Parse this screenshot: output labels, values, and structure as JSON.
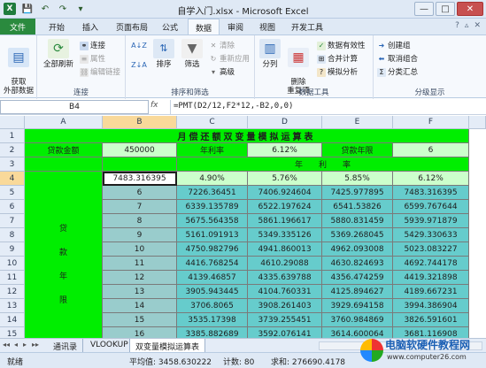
{
  "window": {
    "title": "自学入门.xlsx - Microsoft Excel",
    "minimize": "—",
    "restore": "□",
    "close": "✕"
  },
  "qat": {
    "logo": "X",
    "save": "💾",
    "undo": "↶",
    "redo": "↷",
    "more": "▾"
  },
  "tabs": [
    "文件",
    "开始",
    "插入",
    "页面布局",
    "公式",
    "数据",
    "审阅",
    "视图",
    "开发工具"
  ],
  "active_tab": "数据",
  "ribbon_right": {
    "help": "?",
    "min": "▵",
    "close": "✕"
  },
  "ribbon": {
    "groups": {
      "get_external": "获取\n外部数据",
      "connections": "连接",
      "sort_filter": "排序和筛选",
      "data_tools": "数据工具",
      "outline": "分级显示"
    },
    "buttons": {
      "get_data": "获取\n外部数据",
      "refresh_all": "全部刷新",
      "connections": "连接",
      "properties": "属性",
      "edit_links": "编辑链接",
      "sort_az": "A↓Z",
      "sort_za": "Z↓A",
      "sort": "排序",
      "filter": "筛选",
      "clear": "清除",
      "reapply": "重新应用",
      "advanced": "高级",
      "split": "分列",
      "remove_dup": "删除\n重复项",
      "validation": "数据有效性",
      "consolidate": "合并计算",
      "whatif": "模拟分析",
      "group": "创建组",
      "ungroup": "取消组合",
      "subtotal": "分类汇总"
    }
  },
  "formula_bar": {
    "name_box": "B4",
    "fx": "fx",
    "formula": "=PMT(D2/12,F2*12,-B2,0,0)"
  },
  "columns": [
    "A",
    "B",
    "C",
    "D",
    "E",
    "F"
  ],
  "rows": [
    "1",
    "2",
    "3",
    "4",
    "5",
    "6",
    "7",
    "8",
    "9",
    "10",
    "11",
    "12",
    "13",
    "14",
    "15",
    "16"
  ],
  "sheet": {
    "title": "月偿还额双变量模拟运算表",
    "loan_amount_label": "贷款金额",
    "loan_amount": "450000",
    "annual_rate_label": "年利率",
    "annual_rate": "6.12%",
    "loan_years_label": "贷款年限",
    "loan_years": "6",
    "rate_header": "年　　利　　率",
    "b4": "7483.316395",
    "rates": [
      "4.90%",
      "5.76%",
      "5.85%",
      "6.12%"
    ],
    "years_label": [
      "贷",
      "款",
      "年",
      "限"
    ],
    "years": [
      "6",
      "7",
      "8",
      "9",
      "10",
      "11",
      "12",
      "13",
      "14",
      "15",
      "16"
    ],
    "table": [
      [
        "7226.36451",
        "7406.924604",
        "7425.977895",
        "7483.316395"
      ],
      [
        "6339.135789",
        "6522.197624",
        "6541.53826",
        "6599.767644"
      ],
      [
        "5675.564358",
        "5861.196617",
        "5880.831459",
        "5939.971879"
      ],
      [
        "5161.091913",
        "5349.335126",
        "5369.268045",
        "5429.330633"
      ],
      [
        "4750.982796",
        "4941.860013",
        "4962.093008",
        "5023.083227"
      ],
      [
        "4416.768254",
        "4610.29088",
        "4630.824693",
        "4692.744178"
      ],
      [
        "4139.46857",
        "4335.639788",
        "4356.474259",
        "4419.321898"
      ],
      [
        "3905.943445",
        "4104.760331",
        "4125.894627",
        "4189.667231"
      ],
      [
        "3706.8065",
        "3908.261403",
        "3929.694158",
        "3994.386904"
      ],
      [
        "3535.17398",
        "3739.255451",
        "3760.984869",
        "3826.591601"
      ],
      [
        "3385.882689",
        "3592.076141",
        "3614.600064",
        "3681.116908"
      ]
    ]
  },
  "sheet_tabs": [
    "通讯录",
    "VLOOKUP",
    "双变量模拟运算表"
  ],
  "sheet_nav": [
    "◂◂",
    "◂",
    "▸",
    "▸▸"
  ],
  "status": {
    "ready": "就绪",
    "average": "平均值: 3458.630222",
    "count": "计数: 80",
    "sum": "求和: 276690.4178"
  },
  "watermark": {
    "line1": "电脑软硬件教程网",
    "line2": "www.computer26.com"
  }
}
